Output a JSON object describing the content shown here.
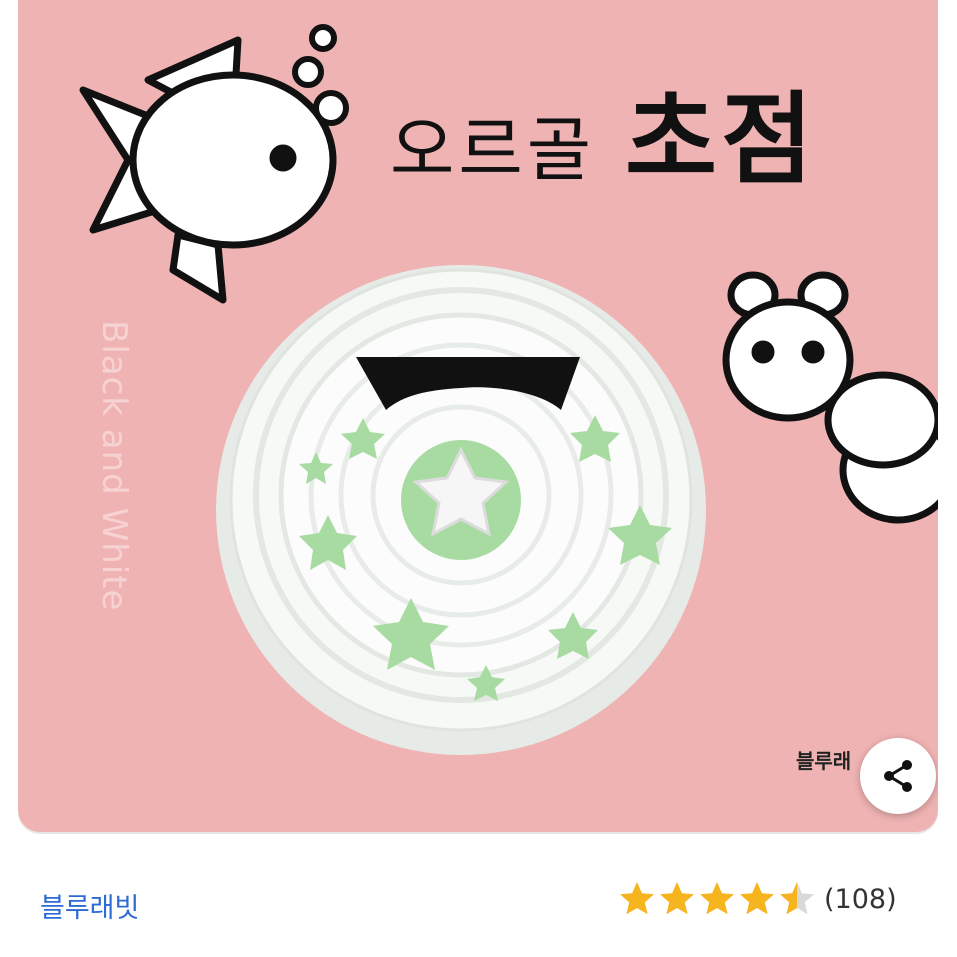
{
  "product": {
    "title_light": "오르골",
    "title_bold": "초점",
    "subtitle_vertical": "Black and White",
    "publisher_mark": "블루래",
    "image_colors": {
      "background": "#efb3b3",
      "star_green": "#a8dba1",
      "toy_white": "#f3f6f3"
    }
  },
  "share": {
    "icon": "share-icon"
  },
  "footer": {
    "publisher": "블루래빗",
    "rating": {
      "value": 4.5,
      "max": 5,
      "count_label": "(108)"
    },
    "star_color": "#f6b41e"
  }
}
